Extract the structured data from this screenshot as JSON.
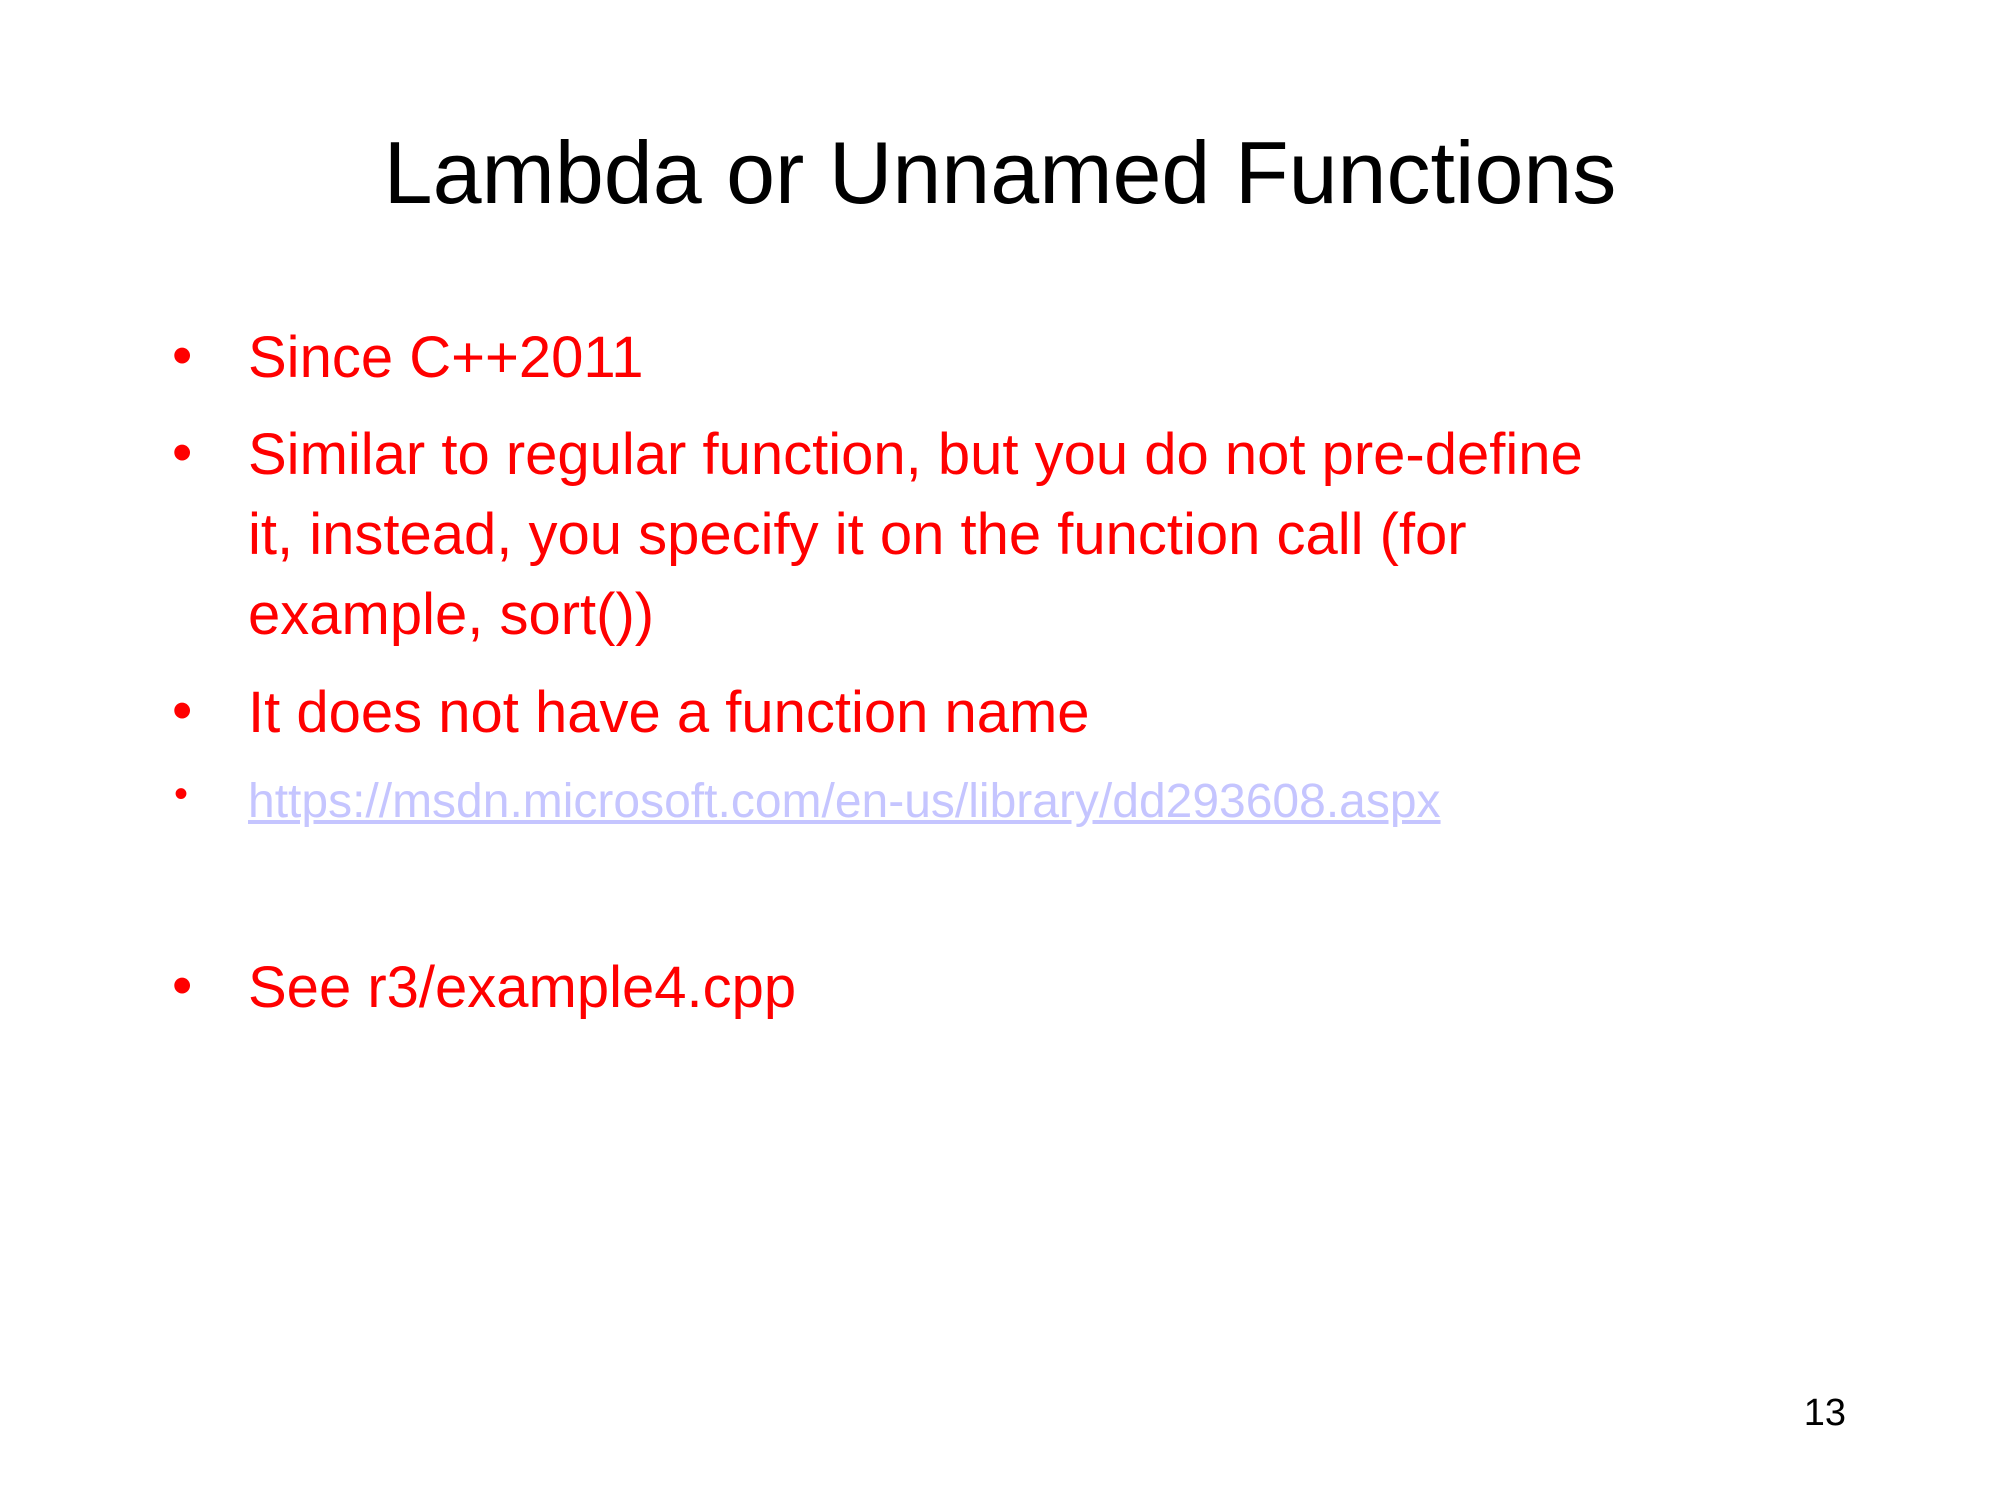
{
  "slide": {
    "title": "Lambda or Unnamed Functions",
    "bullet_symbol": "•",
    "bullets": [
      "Since C++2011",
      "Similar to regular function, but you do not pre-define\nit, instead, you specify it on the function call (for\nexample, sort())",
      "It does not have a function name",
      "https://msdn.microsoft.com/en-us/library/dd293608.aspx",
      "See r3/example4.cpp"
    ],
    "page_number": "13",
    "colors": {
      "title": "#000000",
      "bullet_text": "#ff0000",
      "link": "#c5c5ff",
      "background": "#ffffff"
    }
  }
}
